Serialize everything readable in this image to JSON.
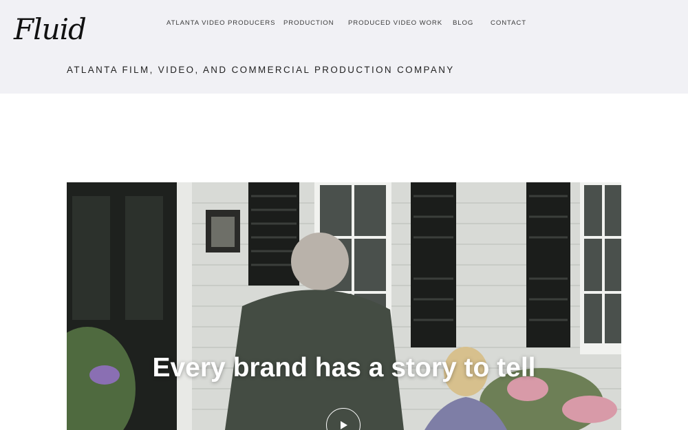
{
  "brand": {
    "logo_text": "Fluid"
  },
  "nav": {
    "items": [
      {
        "label": "ATLANTA VIDEO PRODUCERS"
      },
      {
        "label": "PRODUCTION"
      },
      {
        "label": "PRODUCED VIDEO WORK"
      },
      {
        "label": "BLOG"
      },
      {
        "label": "CONTACT"
      }
    ]
  },
  "header": {
    "tagline": "ATLANTA FILM, VIDEO, AND COMMERCIAL PRODUCTION COMPANY"
  },
  "hero": {
    "headline": "Every brand has a story to tell",
    "play_icon": "play-icon"
  },
  "colors": {
    "header_bg": "#f1f1f5",
    "page_bg": "#ffffff",
    "hero_text": "#ffffff"
  }
}
